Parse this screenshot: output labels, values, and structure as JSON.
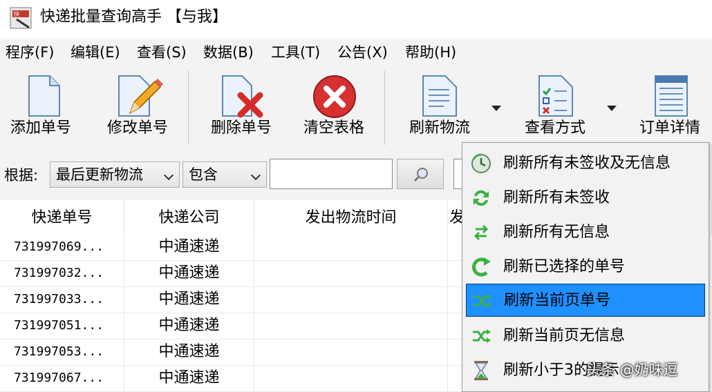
{
  "window": {
    "title": "快递批量查询高手 【与我】"
  },
  "menu": [
    "程序(F)",
    "编辑(E)",
    "查看(S)",
    "数据(B)",
    "工具(T)",
    "公告(X)",
    "帮助(H)"
  ],
  "toolbar": {
    "add": "添加单号",
    "edit": "修改单号",
    "delete": "删除单号",
    "clear": "清空表格",
    "refresh": "刷新物流",
    "view_mode": "查看方式",
    "order_detail": "订单详情"
  },
  "filter": {
    "label": "根据:",
    "field_value": "最后更新物流",
    "match_value": "包含",
    "search_value": ""
  },
  "table": {
    "columns": [
      "快递单号",
      "快递公司",
      "发出物流时间",
      "发"
    ],
    "rows": [
      {
        "no": "731997069...",
        "company": "中通速递"
      },
      {
        "no": "731997032...",
        "company": "中通速递"
      },
      {
        "no": "731997033...",
        "company": "中通速递"
      },
      {
        "no": "731997051...",
        "company": "中通速递"
      },
      {
        "no": "731997053...",
        "company": "中通速递"
      },
      {
        "no": "731997067...",
        "company": "中通速递"
      }
    ]
  },
  "refresh_menu": {
    "items": [
      "刷新所有未签收及无信息",
      "刷新所有未签收",
      "刷新所有无信息",
      "刷新已选择的单号",
      "刷新当前页单号",
      "刷新当前页无信息",
      "刷新小于3的提示"
    ],
    "selected_index": 4
  },
  "watermark": "头条 @奶味逗",
  "colors": {
    "selection": "#1e90ff",
    "menu_bg": "#f2f2f2",
    "toolbar_bg": "#f3f3f3"
  }
}
